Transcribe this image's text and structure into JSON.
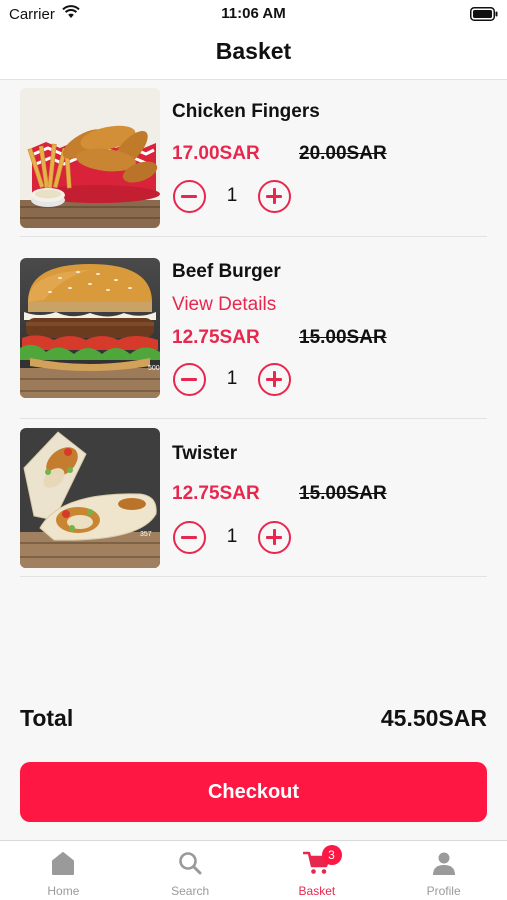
{
  "status_bar": {
    "carrier": "Carrier",
    "time": "11:06 AM"
  },
  "header": {
    "title": "Basket"
  },
  "basket": {
    "items": [
      {
        "name": "Chicken Fingers",
        "price": "17.00SAR",
        "old_price": "20.00SAR",
        "quantity": "1"
      },
      {
        "name": "Beef Burger",
        "details_link": "View Details",
        "price": "12.75SAR",
        "old_price": "15.00SAR",
        "quantity": "1"
      },
      {
        "name": "Twister",
        "price": "12.75SAR",
        "old_price": "15.00SAR",
        "quantity": "1"
      }
    ]
  },
  "total": {
    "label": "Total",
    "value": "45.50SAR"
  },
  "checkout": {
    "label": "Checkout"
  },
  "tab_bar": {
    "items": [
      {
        "label": "Home",
        "icon": "home-icon"
      },
      {
        "label": "Search",
        "icon": "search-icon"
      },
      {
        "label": "Basket",
        "icon": "cart-icon",
        "badge": "3",
        "active": true
      },
      {
        "label": "Profile",
        "icon": "person-icon"
      }
    ]
  },
  "colors": {
    "accent": "#e8274e",
    "checkout_bg": "#ff1744",
    "inactive_tab": "#9a9a9a"
  }
}
